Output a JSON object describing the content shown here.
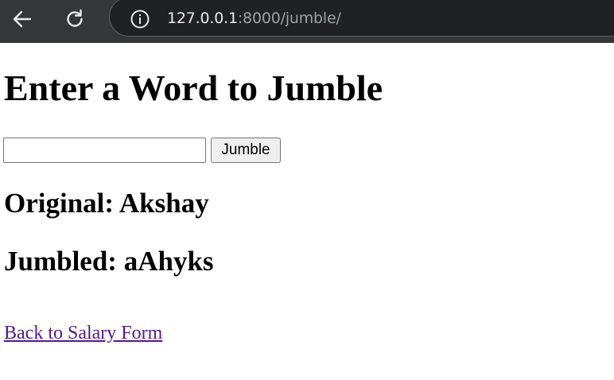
{
  "browser": {
    "url_host": "127.0.0.1",
    "url_rest": ":8000/jumble/"
  },
  "page": {
    "heading": "Enter a Word to Jumble",
    "input_value": "",
    "jumble_button_label": "Jumble",
    "original_text": "Original: Akshay",
    "jumbled_text": "Jumbled: aAhyks",
    "back_link_text": "Back to Salary Form"
  },
  "colors": {
    "browser_bar": "#35363a",
    "omnibox": "#202124",
    "visited_link": "#551a8b"
  }
}
